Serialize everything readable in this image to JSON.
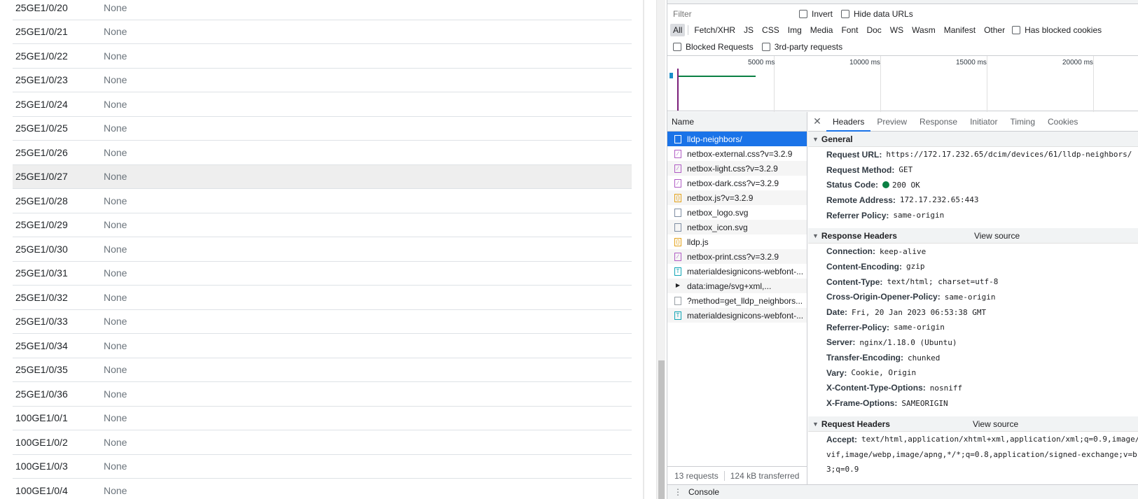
{
  "lldp_rows": [
    {
      "interface": "25GE1/0/20",
      "value": "None"
    },
    {
      "interface": "25GE1/0/21",
      "value": "None"
    },
    {
      "interface": "25GE1/0/22",
      "value": "None"
    },
    {
      "interface": "25GE1/0/23",
      "value": "None"
    },
    {
      "interface": "25GE1/0/24",
      "value": "None"
    },
    {
      "interface": "25GE1/0/25",
      "value": "None"
    },
    {
      "interface": "25GE1/0/26",
      "value": "None"
    },
    {
      "interface": "25GE1/0/27",
      "value": "None"
    },
    {
      "interface": "25GE1/0/28",
      "value": "None"
    },
    {
      "interface": "25GE1/0/29",
      "value": "None"
    },
    {
      "interface": "25GE1/0/30",
      "value": "None"
    },
    {
      "interface": "25GE1/0/31",
      "value": "None"
    },
    {
      "interface": "25GE1/0/32",
      "value": "None"
    },
    {
      "interface": "25GE1/0/33",
      "value": "None"
    },
    {
      "interface": "25GE1/0/34",
      "value": "None"
    },
    {
      "interface": "25GE1/0/35",
      "value": "None"
    },
    {
      "interface": "25GE1/0/36",
      "value": "None"
    },
    {
      "interface": "100GE1/0/1",
      "value": "None"
    },
    {
      "interface": "100GE1/0/2",
      "value": "None"
    },
    {
      "interface": "100GE1/0/3",
      "value": "None"
    },
    {
      "interface": "100GE1/0/4",
      "value": "None"
    }
  ],
  "devtools": {
    "filter": {
      "placeholder": "Filter",
      "invert": "Invert",
      "hide_data_urls": "Hide data URLs"
    },
    "types": [
      "All",
      "Fetch/XHR",
      "JS",
      "CSS",
      "Img",
      "Media",
      "Font",
      "Doc",
      "WS",
      "Wasm",
      "Manifest",
      "Other"
    ],
    "has_blocked_cookies": "Has blocked cookies",
    "blocked_requests": "Blocked Requests",
    "third_party": "3rd-party requests",
    "timeline_labels": [
      "5000 ms",
      "10000 ms",
      "15000 ms",
      "20000 ms"
    ],
    "name_header": "Name",
    "requests": [
      {
        "name": "lldp-neighbors/",
        "kind": "doc"
      },
      {
        "name": "netbox-external.css?v=3.2.9",
        "kind": "css"
      },
      {
        "name": "netbox-light.css?v=3.2.9",
        "kind": "css"
      },
      {
        "name": "netbox-dark.css?v=3.2.9",
        "kind": "css"
      },
      {
        "name": "netbox.js?v=3.2.9",
        "kind": "js"
      },
      {
        "name": "netbox_logo.svg",
        "kind": "img"
      },
      {
        "name": "netbox_icon.svg",
        "kind": "img"
      },
      {
        "name": "lldp.js",
        "kind": "js"
      },
      {
        "name": "netbox-print.css?v=3.2.9",
        "kind": "css"
      },
      {
        "name": "materialdesignicons-webfont-...",
        "kind": "font"
      },
      {
        "name": "data:image/svg+xml,...",
        "kind": "data"
      },
      {
        "name": "?method=get_lldp_neighbors...",
        "kind": "other"
      },
      {
        "name": "materialdesignicons-webfont-...",
        "kind": "font"
      }
    ],
    "status": {
      "requests": "13 requests",
      "transferred": "124 kB transferred"
    },
    "tabs": [
      "Headers",
      "Preview",
      "Response",
      "Initiator",
      "Timing",
      "Cookies"
    ],
    "general": {
      "title": "General",
      "items": [
        {
          "k": "Request URL:",
          "v": "https://172.17.232.65/dcim/devices/61/lldp-neighbors/"
        },
        {
          "k": "Request Method:",
          "v": "GET"
        },
        {
          "k": "Status Code:",
          "v": "200 OK"
        },
        {
          "k": "Remote Address:",
          "v": "172.17.232.65:443"
        },
        {
          "k": "Referrer Policy:",
          "v": "same-origin"
        }
      ]
    },
    "response_headers": {
      "title": "Response Headers",
      "view_source": "View source",
      "items": [
        {
          "k": "Connection:",
          "v": "keep-alive"
        },
        {
          "k": "Content-Encoding:",
          "v": "gzip"
        },
        {
          "k": "Content-Type:",
          "v": "text/html; charset=utf-8"
        },
        {
          "k": "Cross-Origin-Opener-Policy:",
          "v": "same-origin"
        },
        {
          "k": "Date:",
          "v": "Fri, 20 Jan 2023 06:53:38 GMT"
        },
        {
          "k": "Referrer-Policy:",
          "v": "same-origin"
        },
        {
          "k": "Server:",
          "v": "nginx/1.18.0 (Ubuntu)"
        },
        {
          "k": "Transfer-Encoding:",
          "v": "chunked"
        },
        {
          "k": "Vary:",
          "v": "Cookie, Origin"
        },
        {
          "k": "X-Content-Type-Options:",
          "v": "nosniff"
        },
        {
          "k": "X-Frame-Options:",
          "v": "SAMEORIGIN"
        }
      ]
    },
    "request_headers": {
      "title": "Request Headers",
      "view_source": "View source",
      "accept_key": "Accept:",
      "accept_lines": [
        "text/html,application/xhtml+xml,application/xml;q=0.9,image/a",
        "vif,image/webp,image/apng,*/*;q=0.8,application/signed-exchange;v=b",
        "3;q=0.9"
      ]
    },
    "drawer": {
      "console": "Console"
    }
  }
}
